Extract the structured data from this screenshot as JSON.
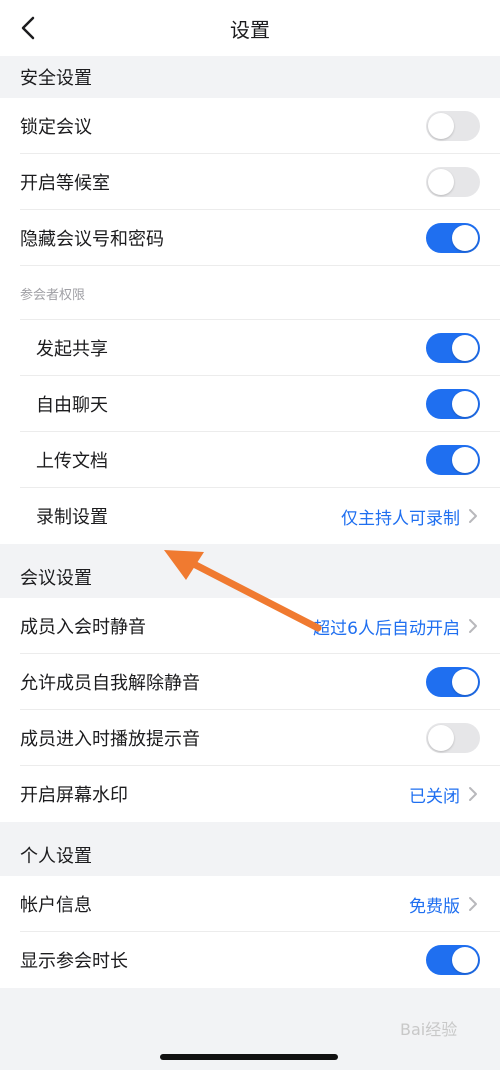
{
  "nav": {
    "title": "设置"
  },
  "security": {
    "header": "安全设置",
    "items": [
      {
        "label": "锁定会议",
        "on": false
      },
      {
        "label": "开启等候室",
        "on": false
      },
      {
        "label": "隐藏会议号和密码",
        "on": true
      }
    ],
    "permissions_header": "参会者权限",
    "permissions": [
      {
        "label": "发起共享",
        "on": true
      },
      {
        "label": "自由聊天",
        "on": true
      },
      {
        "label": "上传文档",
        "on": true
      }
    ],
    "recording": {
      "label": "录制设置",
      "value": "仅主持人可录制"
    }
  },
  "meeting": {
    "header": "会议设置",
    "mute_on_join": {
      "label": "成员入会时静音",
      "value": "超过6人后自动开启"
    },
    "allow_unmute": {
      "label": "允许成员自我解除静音",
      "on": true
    },
    "join_sound": {
      "label": "成员进入时播放提示音",
      "on": false
    },
    "watermark": {
      "label": "开启屏幕水印",
      "value": "已关闭"
    }
  },
  "personal": {
    "header": "个人设置",
    "account": {
      "label": "帐户信息",
      "value": "免费版"
    },
    "show_duration": {
      "label": "显示参会时长",
      "on": true
    }
  },
  "watermark_text": "Bai经验",
  "colors": {
    "accent": "#1f6ff0",
    "arrow": "#f07a30"
  }
}
